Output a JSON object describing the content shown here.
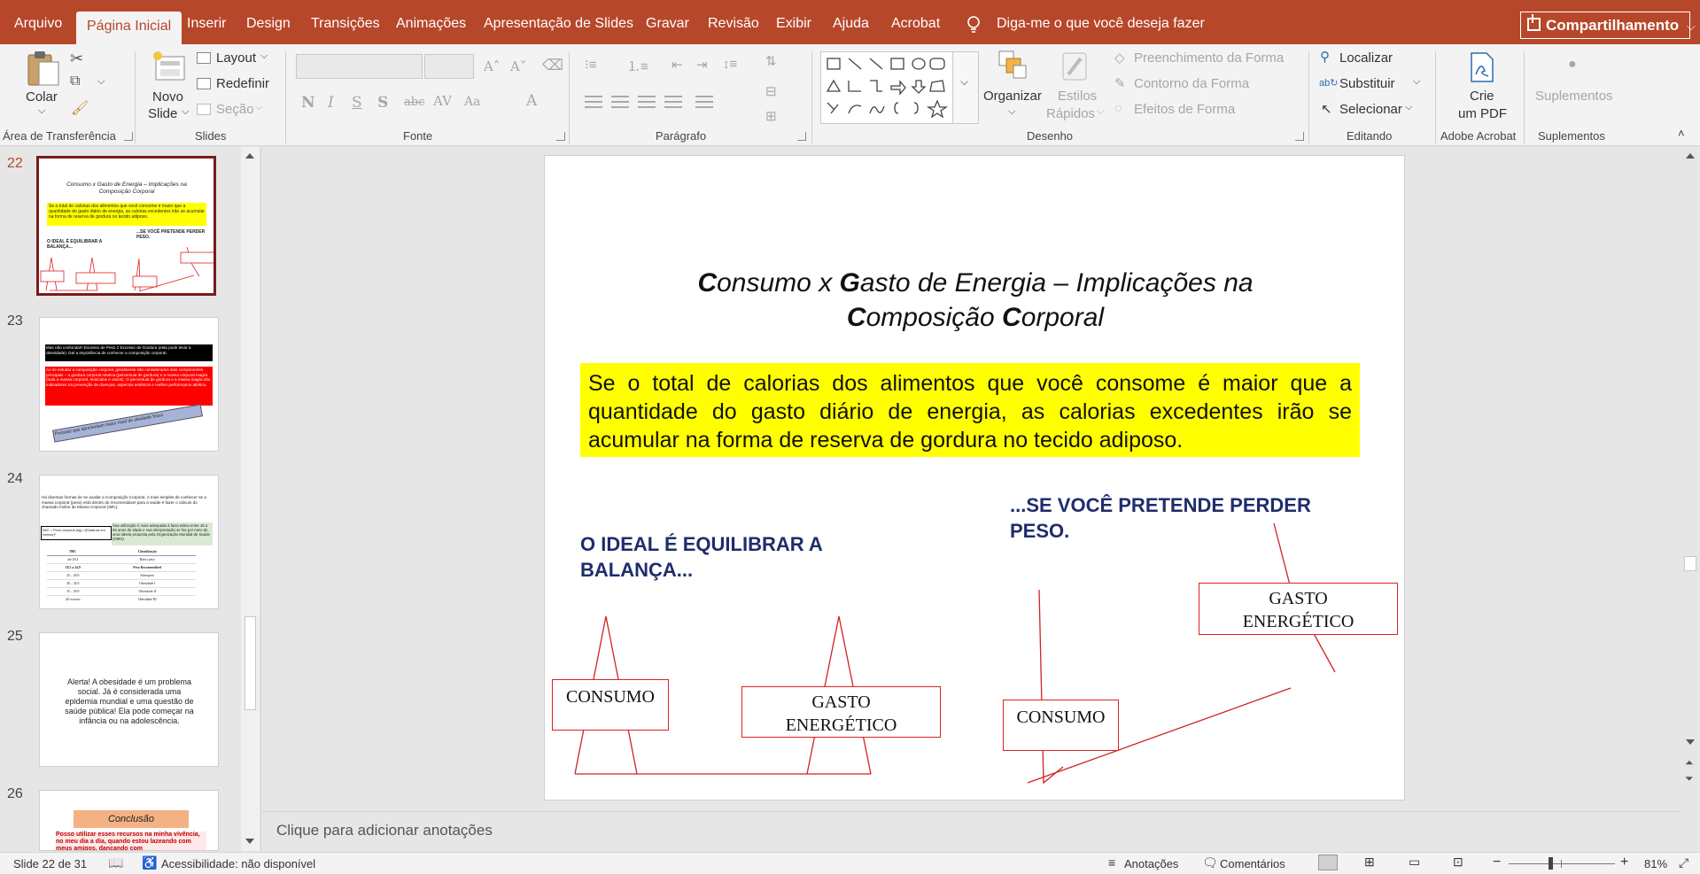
{
  "tabs": {
    "arquivo": "Arquivo",
    "pagina_inicial": "Página Inicial",
    "inserir": "Inserir",
    "design": "Design",
    "transicoes": "Transições",
    "animacoes": "Animações",
    "apresentacao": "Apresentação de Slides",
    "gravar": "Gravar",
    "revisao": "Revisão",
    "exibir": "Exibir",
    "ajuda": "Ajuda",
    "acrobat": "Acrobat",
    "tell_me": "Diga-me o que você deseja fazer",
    "share": "Compartilhamento"
  },
  "ribbon": {
    "clipboard": {
      "label": "Área de Transferência",
      "paste": "Colar"
    },
    "slides": {
      "label": "Slides",
      "new_slide_line1": "Novo",
      "new_slide_line2": "Slide",
      "layout": "Layout",
      "reset": "Redefinir",
      "section": "Seção"
    },
    "font": {
      "label": "Fonte"
    },
    "paragraph": {
      "label": "Parágrafo"
    },
    "drawing": {
      "label": "Desenho",
      "arrange": "Organizar",
      "quick_styles_line1": "Estilos",
      "quick_styles_line2": "Rápidos",
      "fill": "Preenchimento da Forma",
      "outline": "Contorno da Forma",
      "effects": "Efeitos de Forma"
    },
    "editing": {
      "label": "Editando",
      "find": "Localizar",
      "replace": "Substituir",
      "select": "Selecionar"
    },
    "acrobat": {
      "label": "Adobe Acrobat",
      "create_line1": "Crie",
      "create_line2": "um PDF"
    },
    "addins": {
      "label": "Suplementos",
      "button": "Suplementos"
    }
  },
  "thumbnails": {
    "numbers": [
      "22",
      "23",
      "24",
      "25",
      "26"
    ],
    "t22": {
      "title": "Consumo x Gasto de Energia – Implicações na Composição Corporal",
      "text": "Se o total de calorias dos alimentos que você consome é maior que a quantidade do gasto diário de energia, as calorias excedentes irão se acumular na forma de reserva de gordura no tecido adiposo.",
      "left": "O IDEAL É EQUILIBRAR A BALANÇA...",
      "right": "...SE VOCÊ PRETENDE PERDER PESO."
    },
    "t23": {
      "black": "Mas não confunda!!! Excesso de Peso ≠ Excesso de Gordura (esta pode levar à obesidade). Daí a importância de conhecer a composição corporal.",
      "red": "Ao se estudar a composição corporal, geralmente são considerados dois componentes principais – a gordura corporal relativa (percentual de gordura) e a massa corporal magra (toda a massa corporal, músculos e ossos). O percentual de gordura e a massa magra são indicadores na prevenção de doenças, aspectos estéticos e melhor performance atlética.",
      "banner": "Pessoas que apresentam maior nível de atividade física"
    },
    "t24": {
      "text": "Há diversas formas de se avaliar a Composição Corporal. A mais simples de conhecer se a massa corporal (peso) está dentro do recomendável para a saúde é fazer o cálculo do chamado Índice de Massa Corporal (IMC).",
      "green": "Sua utilização é mais adequada à faixa etária entre 18 a 65 anos de idade e sua interpretação se faz por meio de uma tabela proposta pela Organização Mundial de Saúde (OMS).",
      "formula": "IMC = Peso corporal (kg) / (Estatura em metros)²",
      "table_head": [
        "IMC",
        "Classificação"
      ],
      "table_rows": [
        [
          "até 18,4",
          "Baixo peso"
        ],
        [
          "18,5 a 24,9",
          "Peso Recomendável"
        ],
        [
          "25 – 29,9",
          "Sobrepeso"
        ],
        [
          "30 – 34,9",
          "Obesidade I"
        ],
        [
          "35 – 39,9",
          "Obesidade II"
        ],
        [
          "40 ou mais",
          "Obesidade III"
        ]
      ]
    },
    "t25": {
      "text": "Alerta! A obesidade é um problema social. Já é considerada uma epidemia mundial e uma questão de saúde pública! Ela pode começar na infância ou na adolescência."
    },
    "t26": {
      "title": "Conclusão",
      "text": "Posso utilizar esses recursos na minha vivência, no meu dia a dia, quando estou lazeando com meus amigos, dançando com"
    }
  },
  "slide": {
    "title_line1": "Consumo x Gasto de Energia – Implicações na",
    "title_line2": "Composição Corporal",
    "yellow_text": "Se o total de calorias dos alimentos que você consome é maior que a quantidade do gasto diário de energia, as calorias excedentes irão se acumular na forma de reserva de gordura no tecido adiposo.",
    "left_heading": "O IDEAL É EQUILIBRAR A BALANÇA...",
    "right_heading": "...SE VOCÊ PRETENDE PERDER PESO.",
    "consumo": "CONSUMO",
    "gasto": "GASTO ENERGÉTICO"
  },
  "notes": {
    "placeholder": "Clique para adicionar anotações"
  },
  "status": {
    "slide_info": "Slide 22 de 31",
    "accessibility": "Acessibilidade: não disponível",
    "notes": "Anotações",
    "comments": "Comentários",
    "zoom": "81%",
    "zoom_level": 0.81
  },
  "colors": {
    "accent": "#b7472a",
    "thumb_selected": "#7b1b1b",
    "slide_line": "#d22222",
    "heading_blue": "#1f2d6b",
    "highlight": "#ffff00"
  }
}
